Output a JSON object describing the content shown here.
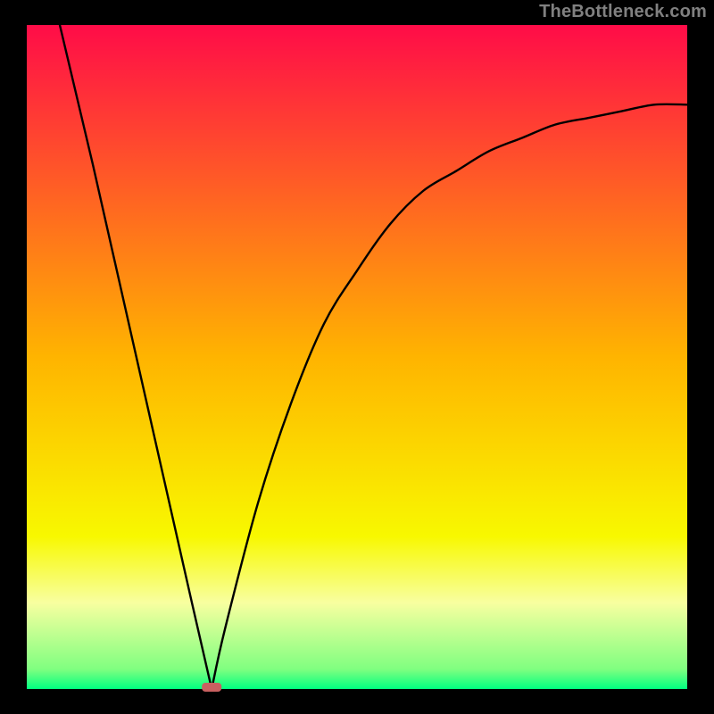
{
  "watermark": "TheBottleneck.com",
  "chart_data": {
    "type": "line",
    "title": "",
    "xlabel": "",
    "ylabel": "",
    "xlim": [
      0,
      100
    ],
    "ylim": [
      0,
      100
    ],
    "note": "V-shaped bottleneck curve on rainbow gradient background. Values are approximate readings from the image (percentages of plot width/height). Minimum (zero) at x≈28.",
    "x": [
      5,
      10,
      15,
      20,
      25,
      28,
      30,
      35,
      40,
      45,
      50,
      55,
      60,
      65,
      70,
      75,
      80,
      85,
      90,
      95,
      100
    ],
    "y": [
      100,
      79,
      57,
      35,
      13,
      0,
      9,
      28,
      43,
      55,
      63,
      70,
      75,
      78,
      81,
      83,
      85,
      86,
      87,
      88,
      88
    ],
    "minimum_marker": {
      "x": 28,
      "y": 0,
      "color": "#c86060"
    },
    "background": {
      "type": "vertical-gradient",
      "stops": [
        {
          "pos": 0.0,
          "color": "#ff0c48"
        },
        {
          "pos": 0.5,
          "color": "#ffb400"
        },
        {
          "pos": 0.77,
          "color": "#f8f800"
        },
        {
          "pos": 0.87,
          "color": "#f8ffa0"
        },
        {
          "pos": 0.97,
          "color": "#80ff80"
        },
        {
          "pos": 1.0,
          "color": "#00ff80"
        }
      ]
    },
    "frame": {
      "color": "#000000",
      "inset_x": 30,
      "inset_y": 28
    }
  }
}
